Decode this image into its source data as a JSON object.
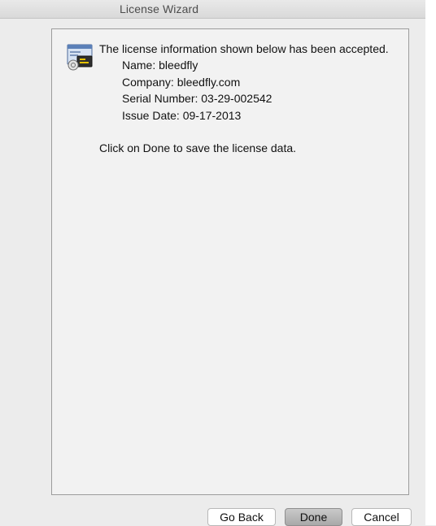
{
  "window": {
    "title": "License Wizard"
  },
  "message": {
    "heading": "The license information shown below has been accepted.",
    "name_line": "Name: bleedfly",
    "company_line": "Company: bleedfly.com",
    "serial_line": "Serial Number: 03-29-002542",
    "issue_date_line": "Issue Date: 09-17-2013",
    "instruction": "Click on Done to save the license data."
  },
  "buttons": {
    "go_back": "Go Back",
    "done": "Done",
    "cancel": "Cancel"
  },
  "icons": {
    "license": "license-certificate-icon"
  },
  "colors": {
    "window_bg": "#ececec",
    "panel_bg": "#f2f2f2",
    "primary_button": "#b3b3b3"
  }
}
